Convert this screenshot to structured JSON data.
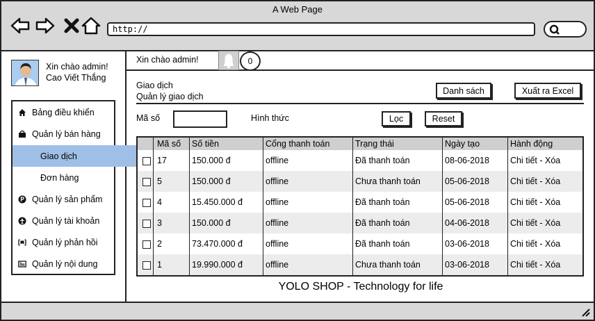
{
  "window": {
    "title": "A Web Page"
  },
  "browser": {
    "url": "http://"
  },
  "user": {
    "greeting": "Xin chào admin!",
    "name": "Cao Viết Thắng"
  },
  "sidebar": {
    "items": [
      {
        "label": "Bảng điều khiển",
        "icon": "home-icon"
      },
      {
        "label": "Quản lý bán hàng",
        "icon": "shopping-bag-icon"
      },
      {
        "label": "Giao dịch",
        "icon": ""
      },
      {
        "label": "Đơn hàng",
        "icon": ""
      },
      {
        "label": "Quản lý sản phẩm",
        "icon": "product-icon"
      },
      {
        "label": "Quản lý tài khoản",
        "icon": "account-icon"
      },
      {
        "label": "Quản lý phản hồi",
        "icon": "feedback-icon"
      },
      {
        "label": "Quản lý nội dung",
        "icon": "content-icon"
      }
    ],
    "active": "Giao dịch"
  },
  "header": {
    "welcome": "Xin chào admin!",
    "notification_count": "0"
  },
  "breadcrumb": {
    "section": "Giao dịch",
    "page": "Quản lý giao dịch"
  },
  "actions": {
    "list_label": "Danh sách",
    "export_label": "Xuất ra Excel"
  },
  "filters": {
    "id_label": "Mã số",
    "id_value": "",
    "method_label": "Hình thức",
    "filter_label": "Lọc",
    "reset_label": "Reset"
  },
  "table": {
    "columns": [
      "Mã số",
      "Số tiền",
      "Cổng thanh toán",
      "Trạng thái",
      "Ngày tạo",
      "Hành động"
    ],
    "rows": [
      [
        "17",
        "150.000 đ",
        "offline",
        "Đã thanh toán",
        "08-06-2018",
        "Chi tiết - Xóa"
      ],
      [
        "5",
        "150.000 đ",
        "offline",
        "Chưa thanh toán",
        "05-06-2018",
        "Chi tiết - Xóa"
      ],
      [
        "4",
        "15.450.000 đ",
        "offline",
        "Đã thanh toán",
        "05-06-2018",
        "Chi tiết - Xóa"
      ],
      [
        "3",
        "150.000 đ",
        "offline",
        "Đã thanh toán",
        "04-06-2018",
        "Chi tiết - Xóa"
      ],
      [
        "2",
        "73.470.000 đ",
        "offline",
        "Đã thanh toán",
        "03-06-2018",
        "Chi tiết - Xóa"
      ],
      [
        "1",
        "19.990.000 đ",
        "offline",
        "Chưa thanh toán",
        "03-06-2018",
        "Chi tiết - Xóa"
      ]
    ]
  },
  "footer": {
    "text": "YOLO SHOP - Technology for life"
  }
}
